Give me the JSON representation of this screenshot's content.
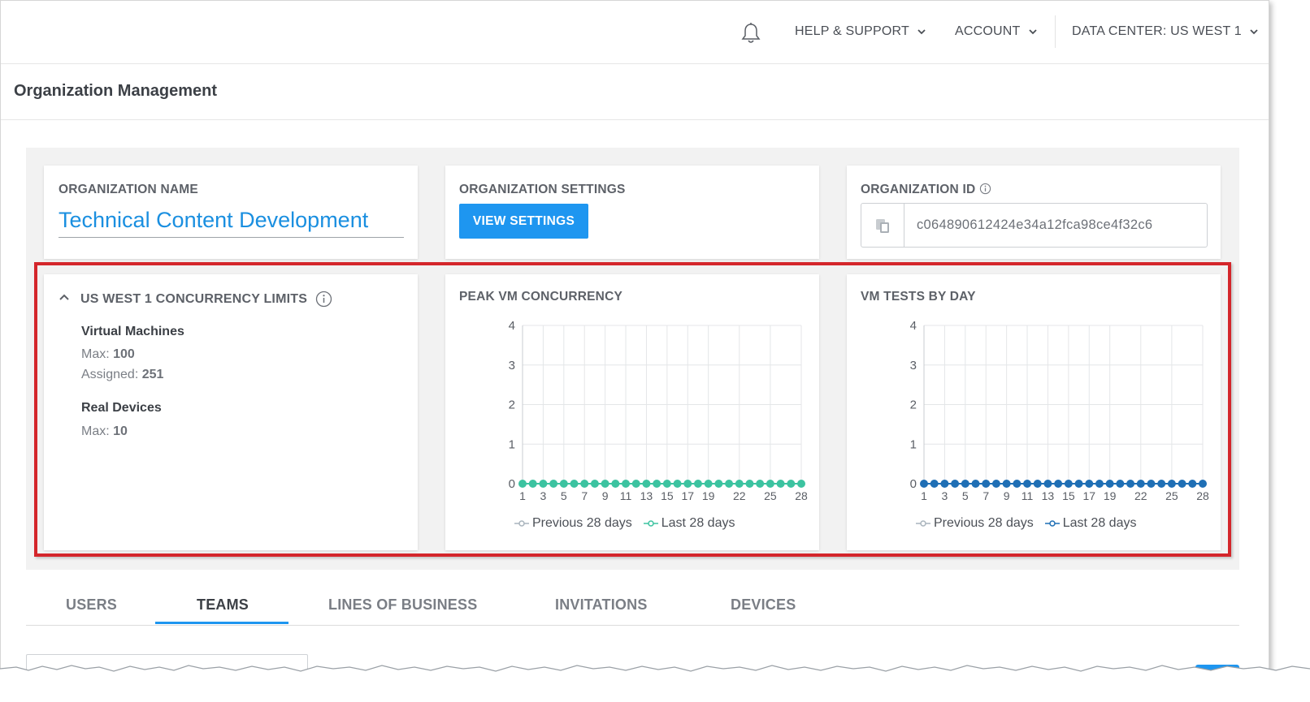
{
  "topbar": {
    "bell_icon": "bell-icon",
    "help_label": "HELP & SUPPORT",
    "account_label": "ACCOUNT",
    "datacenter_label": "DATA CENTER: US WEST 1"
  },
  "page": {
    "title": "Organization Management"
  },
  "org_name": {
    "heading": "ORGANIZATION NAME",
    "value": "Technical Content Development"
  },
  "org_settings": {
    "heading": "ORGANIZATION SETTINGS",
    "button_label": "VIEW SETTINGS"
  },
  "org_id": {
    "heading": "ORGANIZATION ID",
    "value": "c064890612424e34a12fca98ce4f32c6",
    "copy_icon": "copy-icon"
  },
  "limits": {
    "heading": "US WEST 1 CONCURRENCY LIMITS",
    "vm": {
      "title": "Virtual Machines",
      "max_label": "Max:",
      "max_value": "100",
      "assigned_label": "Assigned:",
      "assigned_value": "251"
    },
    "rd": {
      "title": "Real Devices",
      "max_label": "Max:",
      "max_value": "10"
    }
  },
  "colors": {
    "accent": "#1e96f0",
    "link": "#1a8fe0",
    "highlight_border": "#d4262b",
    "teal": "#3cc3a0",
    "blue_series": "#1f6fb5",
    "prev_series": "#a9b4bd"
  },
  "chart_data": [
    {
      "type": "line",
      "title": "PEAK VM CONCURRENCY",
      "x": [
        1,
        2,
        3,
        4,
        5,
        6,
        7,
        8,
        9,
        10,
        11,
        12,
        13,
        14,
        15,
        16,
        17,
        18,
        19,
        20,
        21,
        22,
        23,
        24,
        25,
        26,
        27,
        28
      ],
      "x_tick_labels": [
        "1",
        "3",
        "5",
        "7",
        "9",
        "11",
        "13",
        "15",
        "17",
        "19",
        "22",
        "25",
        "28"
      ],
      "ylim": [
        0,
        4
      ],
      "y_ticks": [
        "0",
        "1",
        "2",
        "3",
        "4"
      ],
      "grid": true,
      "legend_position": "bottom",
      "series": [
        {
          "name": "Previous 28 days",
          "color": "#a9b4bd",
          "values": []
        },
        {
          "name": "Last 28 days",
          "color": "#3cc3a0",
          "values": [
            0,
            0,
            0,
            0,
            0,
            0,
            0,
            0,
            0,
            0,
            0,
            0,
            0,
            0,
            0,
            0,
            0,
            0,
            0,
            0,
            0,
            0,
            0,
            0,
            0,
            0,
            0,
            0
          ]
        }
      ]
    },
    {
      "type": "line",
      "title": "VM TESTS BY DAY",
      "x": [
        1,
        2,
        3,
        4,
        5,
        6,
        7,
        8,
        9,
        10,
        11,
        12,
        13,
        14,
        15,
        16,
        17,
        18,
        19,
        20,
        21,
        22,
        23,
        24,
        25,
        26,
        27,
        28
      ],
      "x_tick_labels": [
        "1",
        "3",
        "5",
        "7",
        "9",
        "11",
        "13",
        "15",
        "17",
        "19",
        "22",
        "25",
        "28"
      ],
      "ylim": [
        0,
        4
      ],
      "y_ticks": [
        "0",
        "1",
        "2",
        "3",
        "4"
      ],
      "grid": true,
      "legend_position": "bottom",
      "series": [
        {
          "name": "Previous 28 days",
          "color": "#a9b4bd",
          "values": []
        },
        {
          "name": "Last 28 days",
          "color": "#1f6fb5",
          "values": [
            0,
            0,
            0,
            0,
            0,
            0,
            0,
            0,
            0,
            0,
            0,
            0,
            0,
            0,
            0,
            0,
            0,
            0,
            0,
            0,
            0,
            0,
            0,
            0,
            0,
            0,
            0,
            0
          ]
        }
      ]
    }
  ],
  "tabs": [
    {
      "label": "USERS",
      "active": false
    },
    {
      "label": "TEAMS",
      "active": true
    },
    {
      "label": "LINES OF BUSINESS",
      "active": false
    },
    {
      "label": "INVITATIONS",
      "active": false
    },
    {
      "label": "DEVICES",
      "active": false
    }
  ]
}
